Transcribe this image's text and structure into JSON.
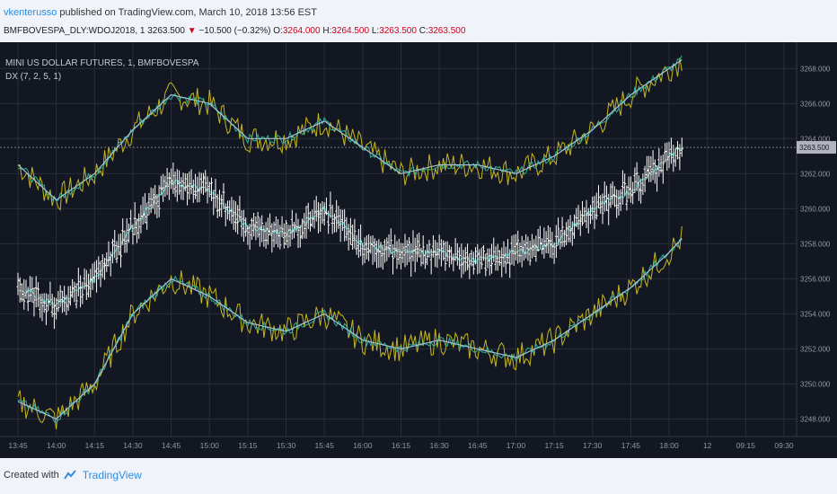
{
  "header": {
    "author": "vkenterusso",
    "published": "published on TradingView.com, March 10, 2018 13:56 EST",
    "symbol": "BMFBOVESPA_DLY:WDOJ2018, 1",
    "last": "3263.500",
    "change_arrow": "▼",
    "change": "−10.500 (−0.32%)",
    "o_label": "O:",
    "o_value": "3264.000",
    "h_label": "H:",
    "h_value": "3264.500",
    "l_label": "L:",
    "l_value": "3263.500",
    "c_label": "C:",
    "c_value": "3263.500"
  },
  "legend": {
    "title": "MINI US DOLLAR FUTURES, 1, BMFBOVESPA",
    "indicator": "DX (7, 2, 5, 1)"
  },
  "footer": {
    "created_with": "Created with",
    "brand": "TradingView"
  },
  "price_tag": "3263.500",
  "colors": {
    "background": "#131722",
    "grid": "#2a2e39",
    "bars": "#ffffff",
    "envelope": "#c5b720",
    "smooth": "#a8c2d8",
    "ma": "#2bb39a",
    "price_tag_bg": "#b2b5be",
    "header_red": "#d0021b",
    "brand_blue": "#2f8ce0"
  },
  "chart_data": {
    "type": "line",
    "title": "MINI US DOLLAR FUTURES, 1, BMFBOVESPA",
    "ylim": [
      3247,
      3269.5
    ],
    "y_ticks": [
      "3248.000",
      "3250.000",
      "3252.000",
      "3254.000",
      "3256.000",
      "3258.000",
      "3260.000",
      "3262.000",
      "3264.000",
      "3266.000",
      "3268.000"
    ],
    "x_ticks": [
      "13:45",
      "14:00",
      "14:15",
      "14:30",
      "14:45",
      "15:00",
      "15:15",
      "15:30",
      "15:45",
      "16:00",
      "16:15",
      "16:30",
      "16:45",
      "17:00",
      "17:15",
      "17:30",
      "17:45",
      "18:00",
      "12",
      "09:15",
      "09:30"
    ],
    "grid": true,
    "series": [
      {
        "kind": "bars",
        "x": [
          "13:45",
          "14:00",
          "14:15",
          "14:30",
          "14:45",
          "15:00",
          "15:15",
          "15:30",
          "15:45",
          "16:00",
          "16:15",
          "16:30",
          "16:45",
          "17:00",
          "17:15",
          "17:30",
          "17:45",
          "18:00",
          "18:05"
        ],
        "values": [
          3255.5,
          3254.5,
          3256,
          3259,
          3261.5,
          3261,
          3259,
          3258.5,
          3260,
          3258,
          3257.5,
          3257.5,
          3257,
          3257.5,
          3258,
          3260,
          3261,
          3263,
          3263.5
        ]
      },
      {
        "kind": "upper",
        "x": [
          "13:45",
          "14:00",
          "14:15",
          "14:30",
          "14:45",
          "15:00",
          "15:15",
          "15:30",
          "15:45",
          "16:00",
          "16:15",
          "16:30",
          "16:45",
          "17:00",
          "17:15",
          "17:30",
          "17:45",
          "18:00",
          "18:05"
        ],
        "values": [
          3262.5,
          3260.5,
          3262,
          3264.5,
          3266.5,
          3266,
          3264,
          3264,
          3265,
          3263.5,
          3262,
          3262.5,
          3262.5,
          3262,
          3263,
          3264.5,
          3266.5,
          3268,
          3268.5
        ]
      },
      {
        "kind": "lower",
        "x": [
          "13:45",
          "14:00",
          "14:15",
          "14:30",
          "14:45",
          "15:00",
          "15:15",
          "15:30",
          "15:45",
          "16:00",
          "16:15",
          "16:30",
          "16:45",
          "17:00",
          "17:15",
          "17:30",
          "17:45",
          "18:00",
          "18:05"
        ],
        "values": [
          3249,
          3248,
          3250,
          3254,
          3256,
          3255,
          3253.5,
          3253,
          3254,
          3252.5,
          3252,
          3252.5,
          3252,
          3251.5,
          3252.5,
          3254,
          3255.5,
          3257.5,
          3258.3
        ]
      }
    ]
  }
}
